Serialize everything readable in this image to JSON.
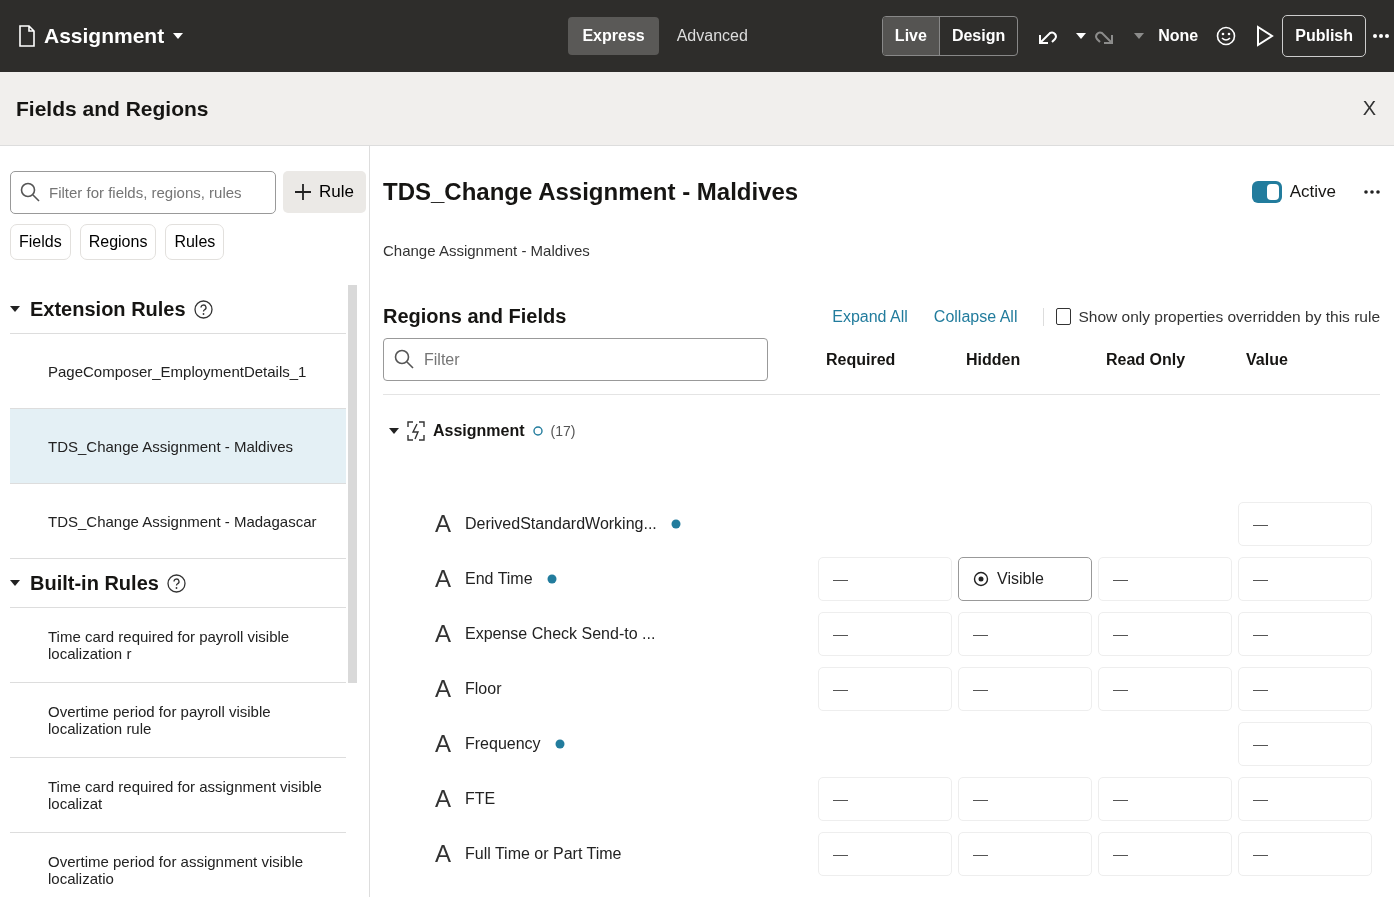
{
  "header": {
    "title": "Assignment",
    "modes": [
      {
        "label": "Express",
        "selected": true
      },
      {
        "label": "Advanced",
        "selected": false
      }
    ],
    "views": [
      {
        "label": "Live",
        "selected": true
      },
      {
        "label": "Design",
        "selected": false
      }
    ],
    "undo": {
      "disabled": false
    },
    "redo": {
      "disabled": true
    },
    "sandbox": "None",
    "publish": "Publish"
  },
  "panel": {
    "title": "Fields and Regions",
    "close": "X"
  },
  "sidebar": {
    "search": {
      "placeholder": "Filter for fields, regions, rules"
    },
    "add_button": "Rule",
    "chips": [
      {
        "label": "Fields",
        "selected": false
      },
      {
        "label": "Regions",
        "selected": false
      },
      {
        "label": "Rules",
        "selected": false
      }
    ],
    "groups": [
      {
        "title": "Extension Rules",
        "expanded": true,
        "items": [
          {
            "label": "PageComposer_EmploymentDetails_1",
            "selected": false
          },
          {
            "label": "TDS_Change Assignment - Maldives",
            "selected": true
          },
          {
            "label": "TDS_Change Assignment - Madagascar",
            "selected": false
          }
        ]
      },
      {
        "title": "Built-in Rules",
        "expanded": true,
        "items": [
          {
            "label": "Time card required for payroll visible localization r",
            "selected": false
          },
          {
            "label": "Overtime period for payroll visible localization rule",
            "selected": false
          },
          {
            "label": "Time card required for assignment visible localizat",
            "selected": false
          },
          {
            "label": "Overtime period for assignment visible localizatio",
            "selected": false
          }
        ]
      }
    ]
  },
  "rule": {
    "title": "TDS_Change Assignment - Maldives",
    "active": {
      "label": "Active",
      "on": true
    },
    "description": "Change Assignment - Maldives",
    "section_title": "Regions and Fields",
    "expand_all": "Expand All",
    "collapse_all": "Collapse All",
    "override_filter": {
      "label": "Show only properties overridden by this rule",
      "checked": false
    },
    "filter": {
      "placeholder": "Filter"
    },
    "columns": [
      "Required",
      "Hidden",
      "Read Only",
      "Value"
    ],
    "region": {
      "name": "Assignment",
      "expanded": true,
      "count": "(17)",
      "fields": [
        {
          "icon": "A",
          "name": "DerivedStandardWorking...",
          "overridden": true,
          "cells": [
            {
              "kind": "none"
            },
            {
              "kind": "none"
            },
            {
              "kind": "none"
            },
            {
              "kind": "dash",
              "text": "—"
            }
          ]
        },
        {
          "icon": "A",
          "name": "End Time",
          "overridden": true,
          "cells": [
            {
              "kind": "dash",
              "text": "—"
            },
            {
              "kind": "option",
              "text": "Visible"
            },
            {
              "kind": "dash",
              "text": "—"
            },
            {
              "kind": "dash",
              "text": "—"
            }
          ]
        },
        {
          "icon": "A",
          "name": "Expense Check Send-to ...",
          "overridden": false,
          "cells": [
            {
              "kind": "dash",
              "text": "—"
            },
            {
              "kind": "dash",
              "text": "—"
            },
            {
              "kind": "dash",
              "text": "—"
            },
            {
              "kind": "dash",
              "text": "—"
            }
          ]
        },
        {
          "icon": "A",
          "name": "Floor",
          "overridden": false,
          "cells": [
            {
              "kind": "dash",
              "text": "—"
            },
            {
              "kind": "dash",
              "text": "—"
            },
            {
              "kind": "dash",
              "text": "—"
            },
            {
              "kind": "dash",
              "text": "—"
            }
          ]
        },
        {
          "icon": "A",
          "name": "Frequency",
          "overridden": true,
          "cells": [
            {
              "kind": "none"
            },
            {
              "kind": "none"
            },
            {
              "kind": "none"
            },
            {
              "kind": "dash",
              "text": "—"
            }
          ]
        },
        {
          "icon": "A",
          "name": "FTE",
          "overridden": false,
          "cells": [
            {
              "kind": "dash",
              "text": "—"
            },
            {
              "kind": "dash",
              "text": "—"
            },
            {
              "kind": "dash",
              "text": "—"
            },
            {
              "kind": "dash",
              "text": "—"
            }
          ]
        },
        {
          "icon": "A",
          "name": "Full Time or Part Time",
          "overridden": false,
          "cells": [
            {
              "kind": "dash",
              "text": "—"
            },
            {
              "kind": "dash",
              "text": "—"
            },
            {
              "kind": "dash",
              "text": "—"
            },
            {
              "kind": "dash",
              "text": "—"
            }
          ]
        }
      ]
    }
  }
}
